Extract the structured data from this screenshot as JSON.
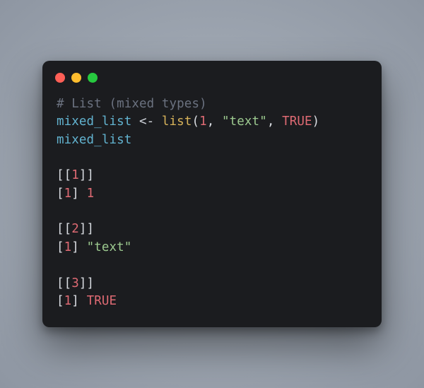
{
  "code": {
    "comment": "# List (mixed types)",
    "line2": {
      "var": "mixed_list",
      "arrow": " <- ",
      "func": "list",
      "lp": "(",
      "arg1": "1",
      "c1": ", ",
      "arg2": "\"text\"",
      "c2": ", ",
      "arg3": "TRUE",
      "rp": ")"
    },
    "line3": "mixed_list"
  },
  "output": {
    "row1": {
      "idx_open": "[[",
      "idx_num": "1",
      "idx_close": "]]",
      "pos": "[",
      "pos_num": "1",
      "pos_close": "] ",
      "val": "1"
    },
    "row2": {
      "idx_open": "[[",
      "idx_num": "2",
      "idx_close": "]]",
      "pos": "[",
      "pos_num": "1",
      "pos_close": "] ",
      "val": "\"text\""
    },
    "row3": {
      "idx_open": "[[",
      "idx_num": "3",
      "idx_close": "]]",
      "pos": "[",
      "pos_num": "1",
      "pos_close": "] ",
      "val": "TRUE"
    }
  },
  "chart_data": {
    "type": "table",
    "title": "R console output: printing mixed_list",
    "categories": [
      "[[1]]",
      "[[2]]",
      "[[3]]"
    ],
    "values": [
      1,
      "text",
      true
    ]
  }
}
